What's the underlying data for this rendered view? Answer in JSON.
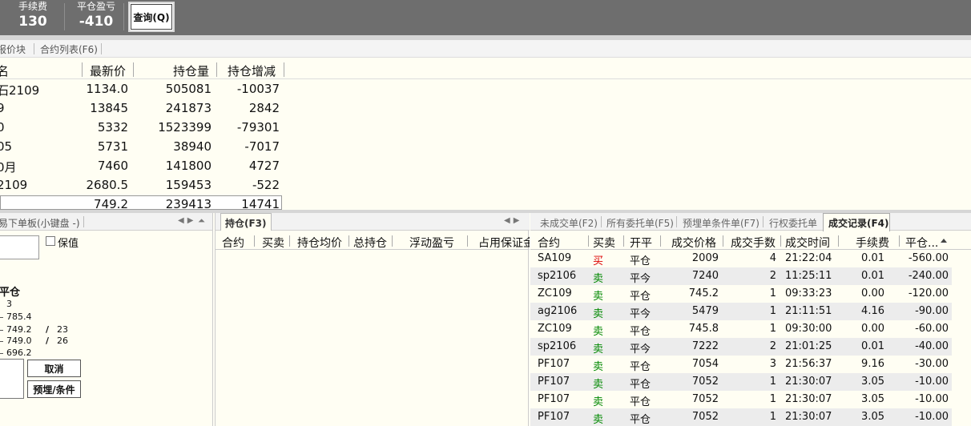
{
  "top": {
    "fee_label": "手续费",
    "fee_value": "130",
    "pnl_label": "平仓盈亏",
    "pnl_value": "-410",
    "query_button": "查询(Q)"
  },
  "quotes": {
    "tabs": [
      "报价块",
      "合约列表(F6)"
    ],
    "headers": [
      "名",
      "最新价",
      "持仓量",
      "持仓增减"
    ],
    "rows": [
      [
        "石2109",
        "1134.0",
        "505081",
        "-10037"
      ],
      [
        "9",
        "13845",
        "241873",
        "2842"
      ],
      [
        "0",
        "5332",
        "1523399",
        "-79301"
      ],
      [
        "05",
        "5731",
        "38940",
        "-7017"
      ],
      [
        "0月",
        "7460",
        "141800",
        "4727"
      ],
      [
        "2109",
        "2680.5",
        "159453",
        "-522"
      ],
      [
        "",
        "749.2",
        "239413",
        "14741"
      ]
    ]
  },
  "order": {
    "title": "易下单板(小键盘 -)",
    "hedge_label": "保值",
    "close_label": "平仓",
    "levels": [
      "3",
      "785.4",
      "749.2",
      "749.0",
      "696.2"
    ],
    "qty_right": [
      "23",
      "26"
    ],
    "cancel_button": "取消",
    "condition_button": "预埋/条件"
  },
  "positions": {
    "tab": "持仓(F3)",
    "headers": [
      "合约",
      "买卖",
      "持仓均价",
      "总持仓",
      "浮动盈亏",
      "占用保证金"
    ]
  },
  "trades": {
    "tabs": [
      "未成交单(F2)",
      "所有委托单(F5)",
      "预埋单条件单(F7)",
      "行权委托单",
      "成交记录(F4)"
    ],
    "headers": [
      "合约",
      "买卖",
      "开平",
      "成交价格",
      "成交手数",
      "成交时间",
      "手续费",
      "平仓..."
    ],
    "rows": [
      [
        "SA109",
        "买",
        "平仓",
        "2009",
        "4",
        "21:22:04",
        "0.01",
        "-560.00"
      ],
      [
        "sp2106",
        "卖",
        "平今",
        "7240",
        "2",
        "11:25:11",
        "0.01",
        "-240.00"
      ],
      [
        "ZC109",
        "卖",
        "平仓",
        "745.2",
        "1",
        "09:33:23",
        "0.00",
        "-120.00"
      ],
      [
        "ag2106",
        "卖",
        "平今",
        "5479",
        "1",
        "21:11:51",
        "4.16",
        "-90.00"
      ],
      [
        "ZC109",
        "卖",
        "平仓",
        "745.8",
        "1",
        "09:30:00",
        "0.00",
        "-60.00"
      ],
      [
        "sp2106",
        "卖",
        "平今",
        "7222",
        "2",
        "21:01:25",
        "0.01",
        "-40.00"
      ],
      [
        "PF107",
        "卖",
        "平仓",
        "7054",
        "3",
        "21:56:37",
        "9.16",
        "-30.00"
      ],
      [
        "PF107",
        "卖",
        "平仓",
        "7052",
        "1",
        "21:30:07",
        "3.05",
        "-10.00"
      ],
      [
        "PF107",
        "卖",
        "平仓",
        "7052",
        "1",
        "21:30:07",
        "3.05",
        "-10.00"
      ],
      [
        "PF107",
        "卖",
        "平仓",
        "7052",
        "1",
        "21:30:07",
        "3.05",
        "-10.00"
      ]
    ]
  },
  "colors": {
    "buy": "#dd0000",
    "sell": "#008800",
    "topbar": "#6e6e6e"
  }
}
